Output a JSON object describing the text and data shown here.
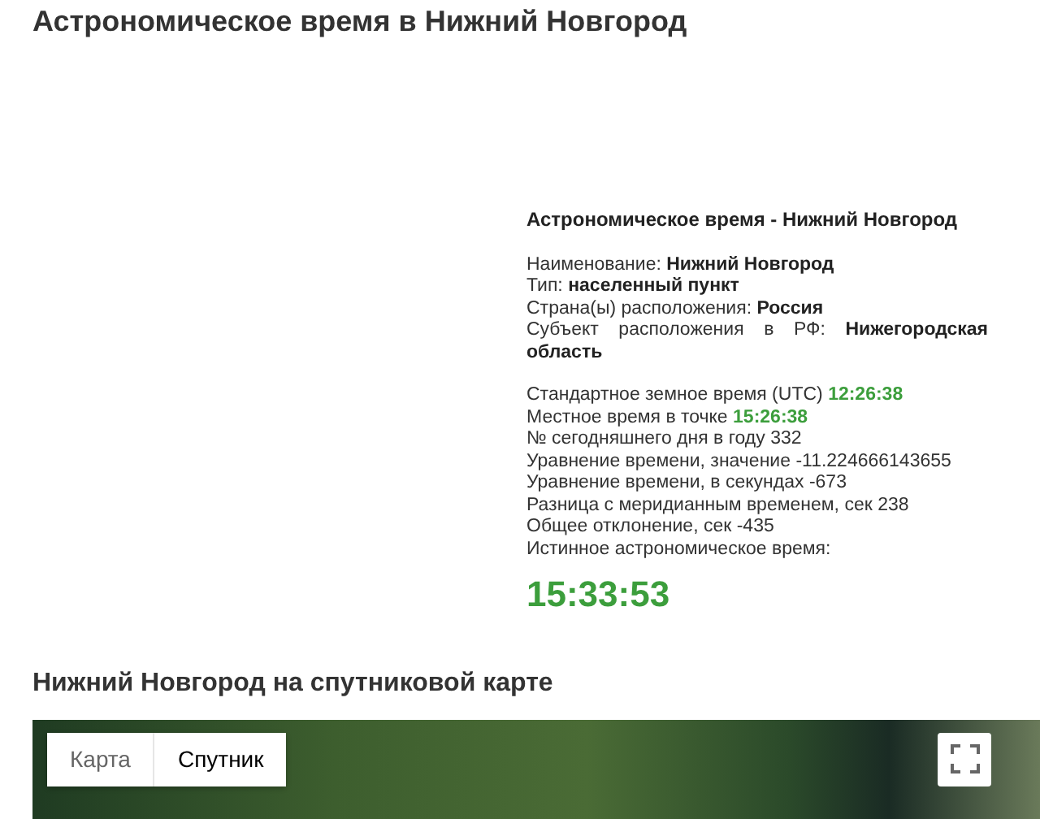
{
  "title": "Астрономическое время в Нижний Новгород",
  "panel": {
    "heading": "Астрономическое время - Нижний Новгород",
    "details": [
      {
        "label": "Наименование:",
        "value": "Нижний Новгород"
      },
      {
        "label": "Тип:",
        "value": "населенный пункт"
      },
      {
        "label": "Страна(ы) расположения:",
        "value": "Россия"
      },
      {
        "label": "Субъект расположения в РФ:",
        "value": "Нижегородская область"
      }
    ],
    "readings": [
      {
        "kind": "time",
        "label": "Стандартное земное время (UTC)",
        "value": "12:26:38"
      },
      {
        "kind": "time",
        "label": "Местное время в точке",
        "value": "15:26:38"
      },
      {
        "kind": "number",
        "label": "№ сегодняшнего дня в году",
        "value": "332"
      },
      {
        "kind": "number",
        "label": "Уравнение времени, значение",
        "value": "-11.224666143655"
      },
      {
        "kind": "number",
        "label": "Уравнение времени, в секундах",
        "value": "-673"
      },
      {
        "kind": "number",
        "label": "Разница с меридианным временем, сек",
        "value": "238"
      },
      {
        "kind": "number",
        "label": "Общее отклонение, сек",
        "value": "-435"
      },
      {
        "kind": "number",
        "label": "Истинное астрономическое время:"
      }
    ],
    "true_time": "15:33:53"
  },
  "map_section": {
    "heading": "Нижний Новгород на спутниковой карте",
    "map_types": [
      {
        "label": "Карта",
        "selected": false
      },
      {
        "label": "Спутник",
        "selected": true
      }
    ]
  }
}
